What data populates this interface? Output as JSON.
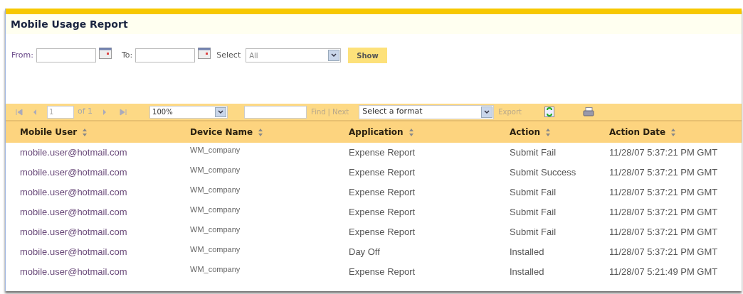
{
  "report": {
    "title": "Mobile Usage Report"
  },
  "filters": {
    "from_label": "From:",
    "to_label": "To:",
    "select_label": "Select",
    "select_value": "All",
    "show_button": "Show"
  },
  "toolbar": {
    "page_value": "1",
    "page_count": "of 1",
    "zoom": "100%",
    "find_link": "Find",
    "link_separator": "|",
    "next_link": "Next",
    "format": "Select a format",
    "export_link": "Export"
  },
  "table": {
    "columns": [
      "Mobile User",
      "Device Name",
      "Application",
      "Action",
      "Action Date"
    ],
    "rows": [
      [
        "mobile.user@hotmail.com",
        "WM_company",
        "Expense Report",
        "Submit Fail",
        "11/28/07 5:37:21 PM GMT"
      ],
      [
        "mobile.user@hotmail.com",
        "WM_company",
        "Expense Report",
        "Submit Success",
        "11/28/07 5:37:21 PM GMT"
      ],
      [
        "mobile.user@hotmail.com",
        "WM_company",
        "Expense Report",
        "Submit Fail",
        "11/28/07 5:37:21 PM GMT"
      ],
      [
        "mobile.user@hotmail.com",
        "WM_company",
        "Expense Report",
        "Submit Fail",
        "11/28/07 5:37:21 PM GMT"
      ],
      [
        "mobile.user@hotmail.com",
        "WM_company",
        "Expense Report",
        "Submit Fail",
        "11/28/07 5:37:21 PM GMT"
      ],
      [
        "mobile.user@hotmail.com",
        "WM_company",
        "Day Off",
        "Installed",
        "11/28/07 5:37:21 PM GMT"
      ],
      [
        "mobile.user@hotmail.com",
        "WM_company",
        "Expense Report",
        "Installed",
        "11/28/07 5:21:49 PM GMT"
      ]
    ]
  }
}
